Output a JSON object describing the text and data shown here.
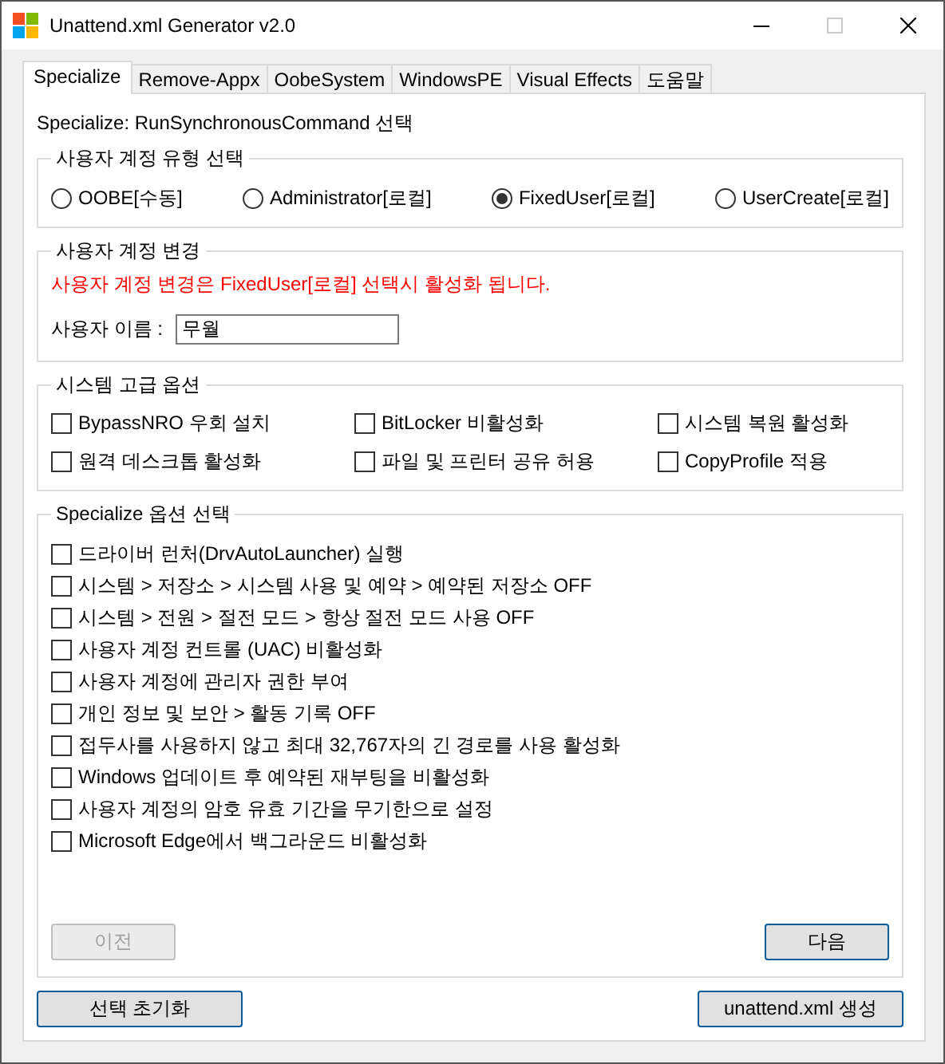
{
  "window": {
    "title": "Unattend.xml Generator v2.0"
  },
  "tabs": [
    {
      "label": "Specialize",
      "selected": true
    },
    {
      "label": "Remove-Appx",
      "selected": false
    },
    {
      "label": "OobeSystem",
      "selected": false
    },
    {
      "label": "WindowsPE",
      "selected": false
    },
    {
      "label": "Visual Effects",
      "selected": false
    },
    {
      "label": "도움말",
      "selected": false
    }
  ],
  "heading": "Specialize: RunSynchronousCommand 선택",
  "account_type": {
    "title": "사용자 계정 유형 선택",
    "options": [
      {
        "label": "OOBE[수동]",
        "selected": false
      },
      {
        "label": "Administrator[로컬]",
        "selected": false
      },
      {
        "label": "FixedUser[로컬]",
        "selected": true
      },
      {
        "label": "UserCreate[로컬]",
        "selected": false
      }
    ]
  },
  "account_change": {
    "title": "사용자 계정 변경",
    "notice": "사용자 계정 변경은 FixedUser[로컬] 선택시 활성화 됩니다.",
    "username": {
      "label": "사용자 이름 :",
      "value": "무월"
    }
  },
  "advanced": {
    "title": "시스템 고급 옵션",
    "options": [
      {
        "label": "BypassNRO 우회 설치",
        "checked": false
      },
      {
        "label": "BitLocker 비활성화",
        "checked": false
      },
      {
        "label": "시스템 복원 활성화",
        "checked": false
      },
      {
        "label": "원격 데스크톱 활성화",
        "checked": false
      },
      {
        "label": "파일 및 프린터 공유 허용",
        "checked": false
      },
      {
        "label": "CopyProfile 적용",
        "checked": false
      }
    ]
  },
  "specialize_options": {
    "title": "Specialize 옵션 선택",
    "options": [
      {
        "label": "드라이버 런처(DrvAutoLauncher) 실행",
        "checked": false
      },
      {
        "label": "시스템 > 저장소 > 시스템 사용 및 예약 > 예약된 저장소 OFF",
        "checked": false
      },
      {
        "label": "시스템 > 전원 > 절전 모드 > 항상 절전 모드 사용 OFF",
        "checked": false
      },
      {
        "label": "사용자 계정 컨트롤 (UAC) 비활성화",
        "checked": false
      },
      {
        "label": "사용자 계정에 관리자 권한 부여",
        "checked": false
      },
      {
        "label": "개인 정보 및 보안 > 활동 기록 OFF",
        "checked": false
      },
      {
        "label": "접두사를 사용하지 않고 최대 32,767자의 긴 경로를 사용 활성화",
        "checked": false
      },
      {
        "label": "Windows 업데이트 후 예약된 재부팅을 비활성화",
        "checked": false
      },
      {
        "label": "사용자 계정의 암호 유효 기간을 무기한으로 설정",
        "checked": false
      },
      {
        "label": "Microsoft Edge에서 백그라운드 비활성화",
        "checked": false
      }
    ],
    "buttons": [
      {
        "label": "이전",
        "disabled": true
      },
      {
        "label": "다음",
        "disabled": false
      }
    ]
  },
  "footer_buttons": [
    {
      "label": "선택 초기화"
    },
    {
      "label": "unattend.xml 생성"
    }
  ]
}
